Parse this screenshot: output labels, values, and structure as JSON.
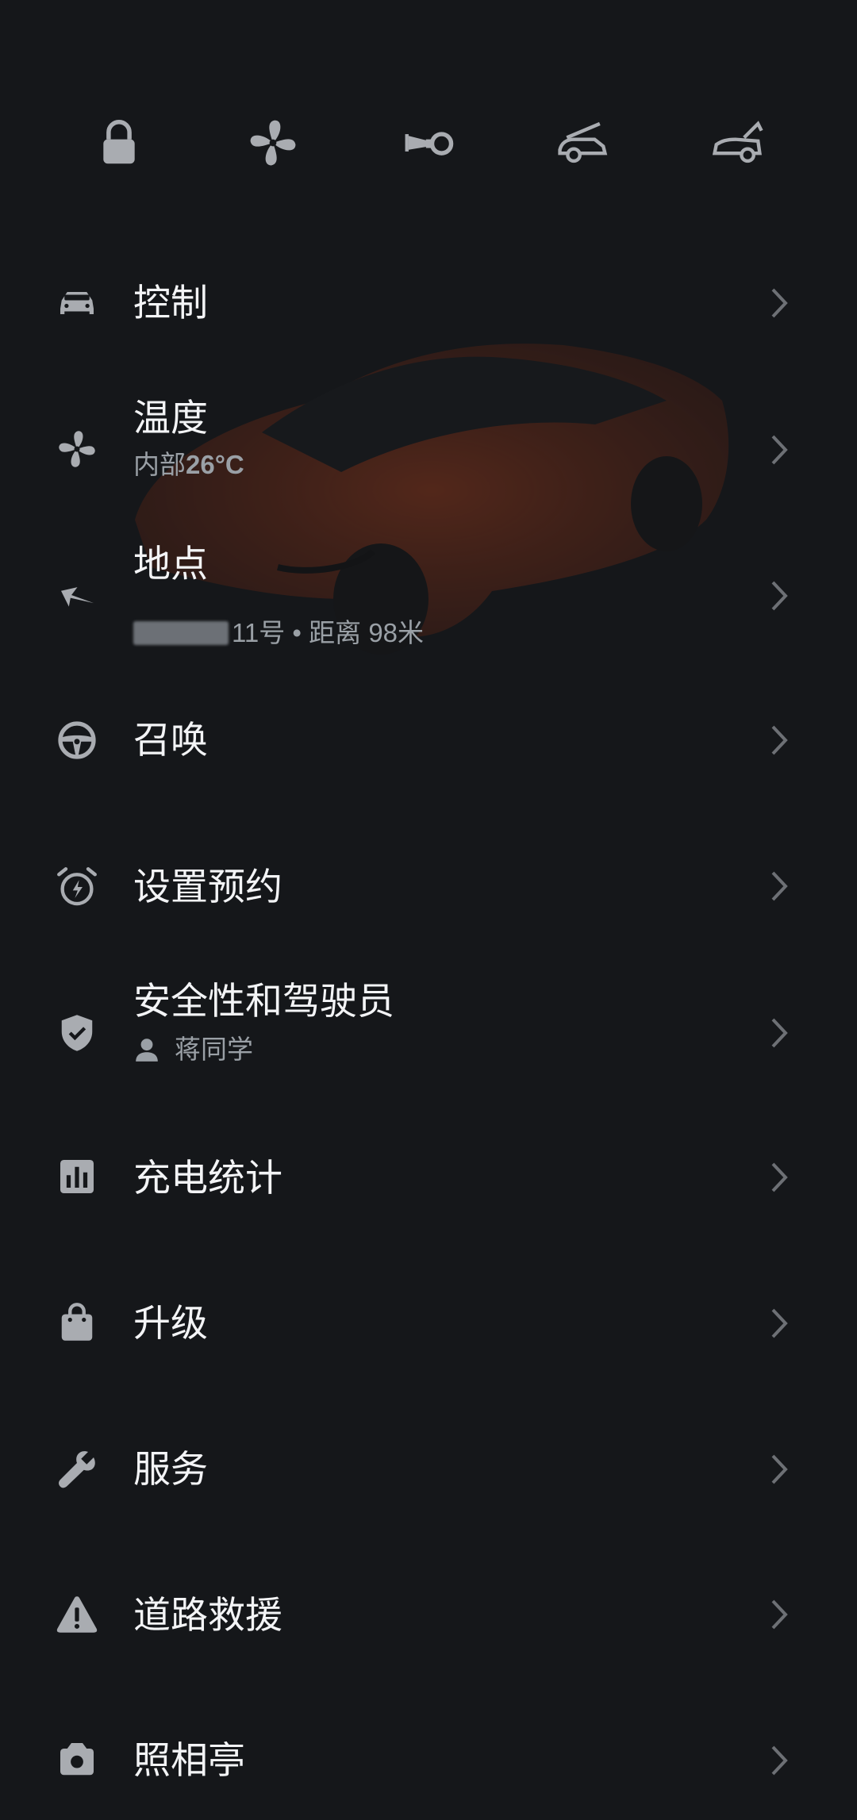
{
  "quick_actions": [
    {
      "name": "lock",
      "icon": "lock-icon"
    },
    {
      "name": "climate",
      "icon": "fan-icon"
    },
    {
      "name": "horn",
      "icon": "horn-icon"
    },
    {
      "name": "frunk",
      "icon": "frunk-icon"
    },
    {
      "name": "trunk",
      "icon": "trunk-icon"
    }
  ],
  "menu": {
    "controls": {
      "title": "控制",
      "icon": "car-icon"
    },
    "climate": {
      "title": "温度",
      "sub_prefix": "内部",
      "sub_value": "26°C",
      "icon": "fan-icon"
    },
    "location": {
      "title": "地点",
      "sub_prefix": "",
      "sub_number": "11号",
      "sub_suffix": " • 距离 98米",
      "icon": "location-arrow-icon"
    },
    "summon": {
      "title": "召唤",
      "icon": "steering-wheel-icon"
    },
    "schedule": {
      "title": "设置预约",
      "icon": "alarm-clock-icon"
    },
    "safety": {
      "title": "安全性和驾驶员",
      "sub": "蒋同学",
      "icon": "shield-check-icon"
    },
    "charging": {
      "title": "充电统计",
      "icon": "bar-chart-icon"
    },
    "upgrades": {
      "title": "升级",
      "icon": "shopping-bag-icon"
    },
    "service": {
      "title": "服务",
      "icon": "wrench-icon"
    },
    "roadside": {
      "title": "道路救援",
      "icon": "warning-icon"
    },
    "more": {
      "title": "照相亭",
      "icon": "camera-icon"
    }
  },
  "colors": {
    "background": "#15171a",
    "icon": "#a9acb1",
    "text": "#f3f4f6",
    "subtext": "#9aa0a6",
    "chevron": "#6d7075",
    "car": "#b8431c"
  }
}
